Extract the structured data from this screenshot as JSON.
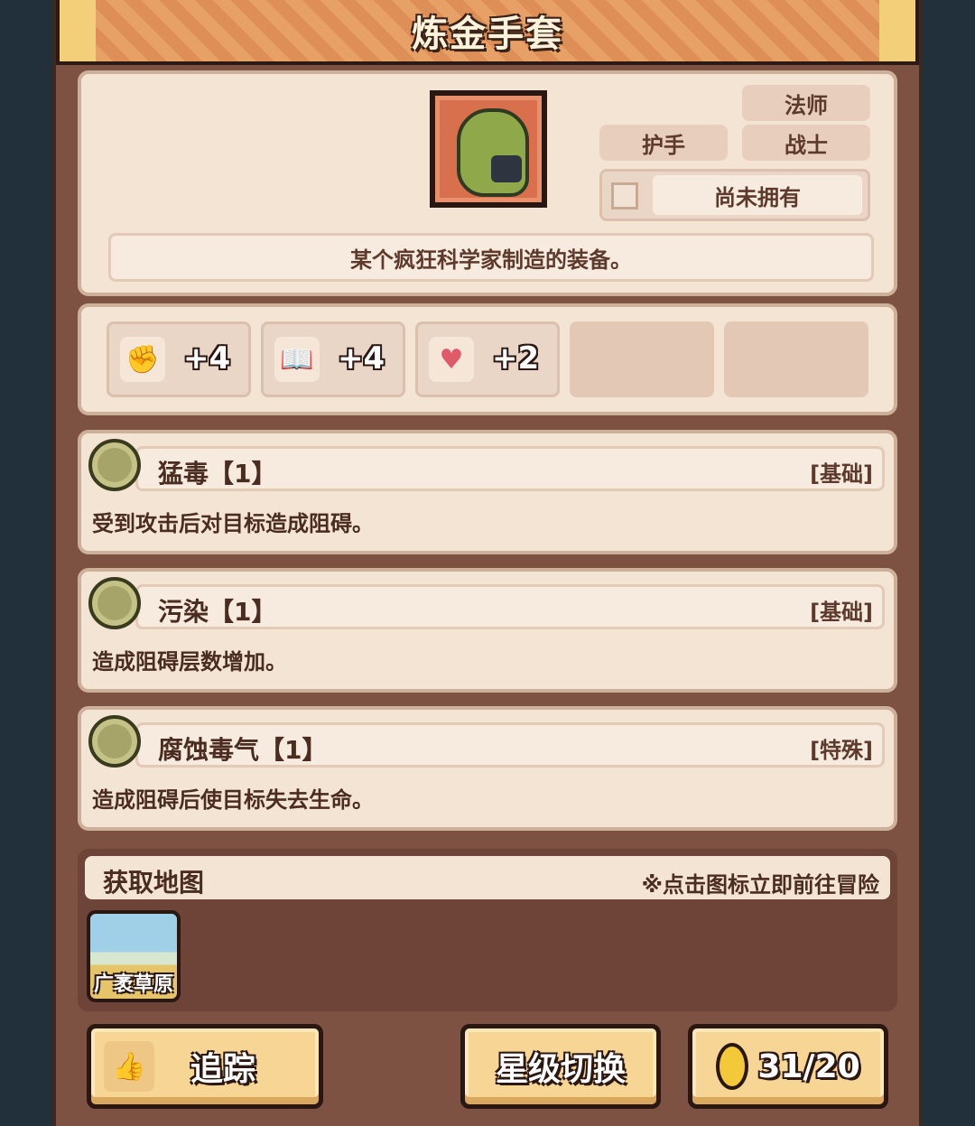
{
  "item": {
    "name": "炼金手套",
    "description": "某个疯狂科学家制造的装备。",
    "icon": "alchemy-glove-icon",
    "tags": {
      "slot": "护手",
      "class_mage": "法师",
      "class_warrior": "战士"
    },
    "ownership": "尚未拥有"
  },
  "stats": [
    {
      "icon": "fist-icon",
      "glyph": "✊",
      "value": "+4"
    },
    {
      "icon": "book-icon",
      "glyph": "📖",
      "value": "+4"
    },
    {
      "icon": "heart-icon",
      "glyph": "♥",
      "value": "+2"
    }
  ],
  "skills": [
    {
      "name": "猛毒【1】",
      "type": "[基础]",
      "desc": "受到攻击后对目标造成阻碍。"
    },
    {
      "name": "污染【1】",
      "type": "[基础]",
      "desc": "造成阻碍层数增加。"
    },
    {
      "name": "腐蚀毒气【1】",
      "type": "[特殊]",
      "desc": "造成阻碍后使目标失去生命。"
    }
  ],
  "maps": {
    "title": "获取地图",
    "hint": "※点击图标立即前往冒险",
    "items": [
      {
        "name": "广袤草原"
      }
    ]
  },
  "buttons": {
    "track": "追踪",
    "star_switch": "星级切换",
    "cost": "31/20"
  }
}
